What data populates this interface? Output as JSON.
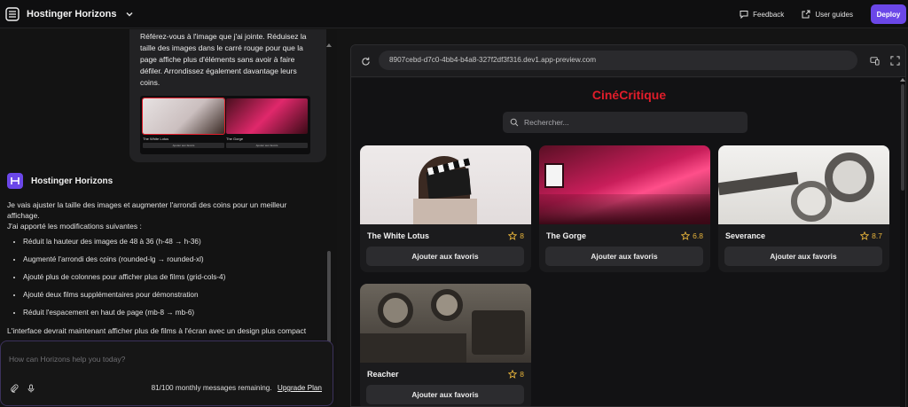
{
  "topbar": {
    "app_name": "Hostinger Horizons",
    "feedback_label": "Feedback",
    "user_guides_label": "User guides",
    "deploy_label": "Deploy",
    "accent_color": "#6b47e8"
  },
  "chat": {
    "user_message_partial": "Référez-vous à l'image que j'ai jointe. Réduisez la",
    "user_message": "taille des images dans le carré rouge pour que la page affiche plus d'éléments sans avoir à faire défiler. Arrondissez également davantage leurs coins.",
    "attachment": {
      "cards": [
        {
          "title": "The White Lotus",
          "button": "Ajouter aux favoris"
        },
        {
          "title": "The Gorge",
          "button": "Ajouter aux favoris"
        }
      ]
    },
    "assistant_name": "Hostinger Horizons",
    "assistant_intro": "Je vais ajuster la taille des images et augmenter l'arrondi des coins pour un meilleur affichage.",
    "assistant_changes_header": "J'ai apporté les modifications suivantes :",
    "assistant_changes": [
      "Réduit la hauteur des images de 48 à 36 (h-48 → h-36)",
      "Augmenté l'arrondi des coins (rounded-lg → rounded-xl)",
      "Ajouté plus de colonnes pour afficher plus de films (grid-cols-4)",
      "Ajouté deux films supplémentaires pour démonstration",
      "Réduit l'espacement en haut de page (mb-8 → mb-6)"
    ],
    "assistant_closing": "L'interface devrait maintenant afficher plus de films à l'écran avec un design plus compact"
  },
  "composer": {
    "placeholder": "How can Horizons help you today?",
    "messages_remaining": "81/100 monthly messages remaining.",
    "upgrade_label": "Upgrade Plan"
  },
  "preview": {
    "url": "8907cebd-d7c0-4bb4-b4a8-327f2df3f316.dev1.app-preview.com",
    "app_title": "CinéCritique",
    "title_color": "#e11d2a",
    "search_placeholder": "Rechercher...",
    "movies": [
      {
        "title": "The White Lotus",
        "rating": "8",
        "button": "Ajouter aux favoris"
      },
      {
        "title": "The Gorge",
        "rating": "6.8",
        "button": "Ajouter aux favoris"
      },
      {
        "title": "Severance",
        "rating": "8.7",
        "button": "Ajouter aux favoris"
      },
      {
        "title": "Reacher",
        "rating": "8",
        "button": "Ajouter aux favoris"
      }
    ]
  }
}
